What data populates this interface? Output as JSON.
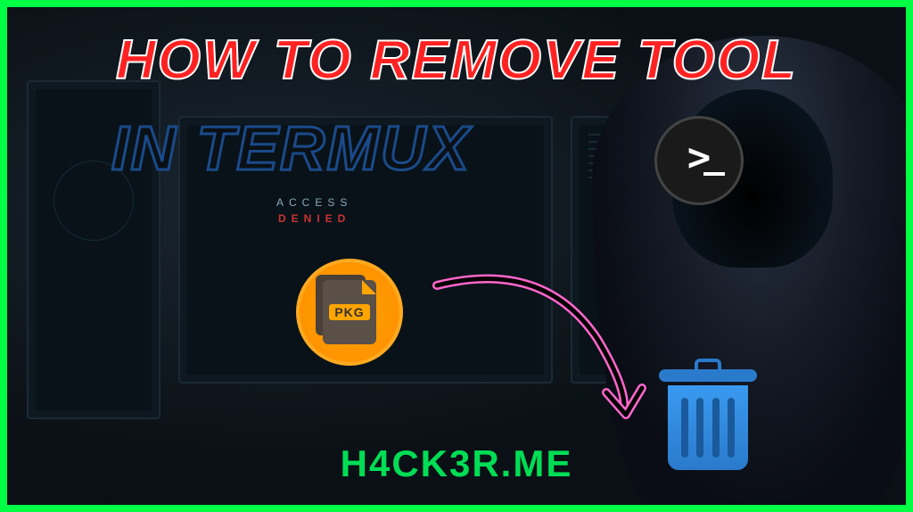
{
  "title": {
    "line1": "HOW TO REMOVE TOOL",
    "line2": "IN TERMUX"
  },
  "monitor": {
    "access_label": "ACCESS",
    "denied_label": "DENIED"
  },
  "icons": {
    "terminal_prompt": ">",
    "pkg_label": "PKG"
  },
  "watermark": "H4CK3R.ME"
}
